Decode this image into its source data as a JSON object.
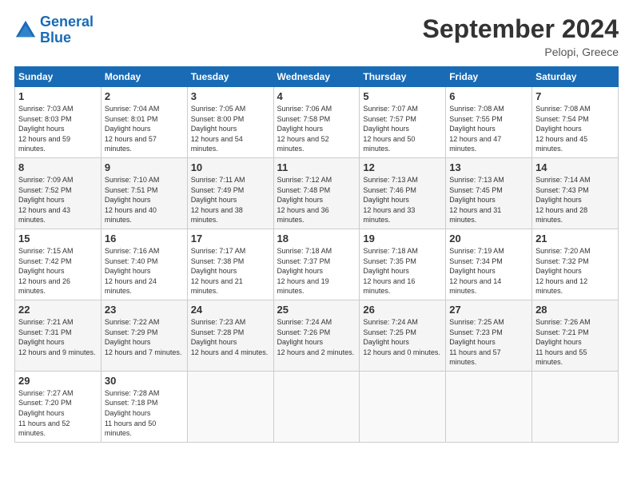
{
  "header": {
    "logo_line1": "General",
    "logo_line2": "Blue",
    "month": "September 2024",
    "location": "Pelopi, Greece"
  },
  "days_of_week": [
    "Sunday",
    "Monday",
    "Tuesday",
    "Wednesday",
    "Thursday",
    "Friday",
    "Saturday"
  ],
  "weeks": [
    [
      {
        "day": "1",
        "sunrise": "7:03 AM",
        "sunset": "8:03 PM",
        "daylight": "12 hours and 59 minutes."
      },
      {
        "day": "2",
        "sunrise": "7:04 AM",
        "sunset": "8:01 PM",
        "daylight": "12 hours and 57 minutes."
      },
      {
        "day": "3",
        "sunrise": "7:05 AM",
        "sunset": "8:00 PM",
        "daylight": "12 hours and 54 minutes."
      },
      {
        "day": "4",
        "sunrise": "7:06 AM",
        "sunset": "7:58 PM",
        "daylight": "12 hours and 52 minutes."
      },
      {
        "day": "5",
        "sunrise": "7:07 AM",
        "sunset": "7:57 PM",
        "daylight": "12 hours and 50 minutes."
      },
      {
        "day": "6",
        "sunrise": "7:08 AM",
        "sunset": "7:55 PM",
        "daylight": "12 hours and 47 minutes."
      },
      {
        "day": "7",
        "sunrise": "7:08 AM",
        "sunset": "7:54 PM",
        "daylight": "12 hours and 45 minutes."
      }
    ],
    [
      {
        "day": "8",
        "sunrise": "7:09 AM",
        "sunset": "7:52 PM",
        "daylight": "12 hours and 43 minutes."
      },
      {
        "day": "9",
        "sunrise": "7:10 AM",
        "sunset": "7:51 PM",
        "daylight": "12 hours and 40 minutes."
      },
      {
        "day": "10",
        "sunrise": "7:11 AM",
        "sunset": "7:49 PM",
        "daylight": "12 hours and 38 minutes."
      },
      {
        "day": "11",
        "sunrise": "7:12 AM",
        "sunset": "7:48 PM",
        "daylight": "12 hours and 36 minutes."
      },
      {
        "day": "12",
        "sunrise": "7:13 AM",
        "sunset": "7:46 PM",
        "daylight": "12 hours and 33 minutes."
      },
      {
        "day": "13",
        "sunrise": "7:13 AM",
        "sunset": "7:45 PM",
        "daylight": "12 hours and 31 minutes."
      },
      {
        "day": "14",
        "sunrise": "7:14 AM",
        "sunset": "7:43 PM",
        "daylight": "12 hours and 28 minutes."
      }
    ],
    [
      {
        "day": "15",
        "sunrise": "7:15 AM",
        "sunset": "7:42 PM",
        "daylight": "12 hours and 26 minutes."
      },
      {
        "day": "16",
        "sunrise": "7:16 AM",
        "sunset": "7:40 PM",
        "daylight": "12 hours and 24 minutes."
      },
      {
        "day": "17",
        "sunrise": "7:17 AM",
        "sunset": "7:38 PM",
        "daylight": "12 hours and 21 minutes."
      },
      {
        "day": "18",
        "sunrise": "7:18 AM",
        "sunset": "7:37 PM",
        "daylight": "12 hours and 19 minutes."
      },
      {
        "day": "19",
        "sunrise": "7:18 AM",
        "sunset": "7:35 PM",
        "daylight": "12 hours and 16 minutes."
      },
      {
        "day": "20",
        "sunrise": "7:19 AM",
        "sunset": "7:34 PM",
        "daylight": "12 hours and 14 minutes."
      },
      {
        "day": "21",
        "sunrise": "7:20 AM",
        "sunset": "7:32 PM",
        "daylight": "12 hours and 12 minutes."
      }
    ],
    [
      {
        "day": "22",
        "sunrise": "7:21 AM",
        "sunset": "7:31 PM",
        "daylight": "12 hours and 9 minutes."
      },
      {
        "day": "23",
        "sunrise": "7:22 AM",
        "sunset": "7:29 PM",
        "daylight": "12 hours and 7 minutes."
      },
      {
        "day": "24",
        "sunrise": "7:23 AM",
        "sunset": "7:28 PM",
        "daylight": "12 hours and 4 minutes."
      },
      {
        "day": "25",
        "sunrise": "7:24 AM",
        "sunset": "7:26 PM",
        "daylight": "12 hours and 2 minutes."
      },
      {
        "day": "26",
        "sunrise": "7:24 AM",
        "sunset": "7:25 PM",
        "daylight": "12 hours and 0 minutes."
      },
      {
        "day": "27",
        "sunrise": "7:25 AM",
        "sunset": "7:23 PM",
        "daylight": "11 hours and 57 minutes."
      },
      {
        "day": "28",
        "sunrise": "7:26 AM",
        "sunset": "7:21 PM",
        "daylight": "11 hours and 55 minutes."
      }
    ],
    [
      {
        "day": "29",
        "sunrise": "7:27 AM",
        "sunset": "7:20 PM",
        "daylight": "11 hours and 52 minutes."
      },
      {
        "day": "30",
        "sunrise": "7:28 AM",
        "sunset": "7:18 PM",
        "daylight": "11 hours and 50 minutes."
      },
      null,
      null,
      null,
      null,
      null
    ]
  ]
}
